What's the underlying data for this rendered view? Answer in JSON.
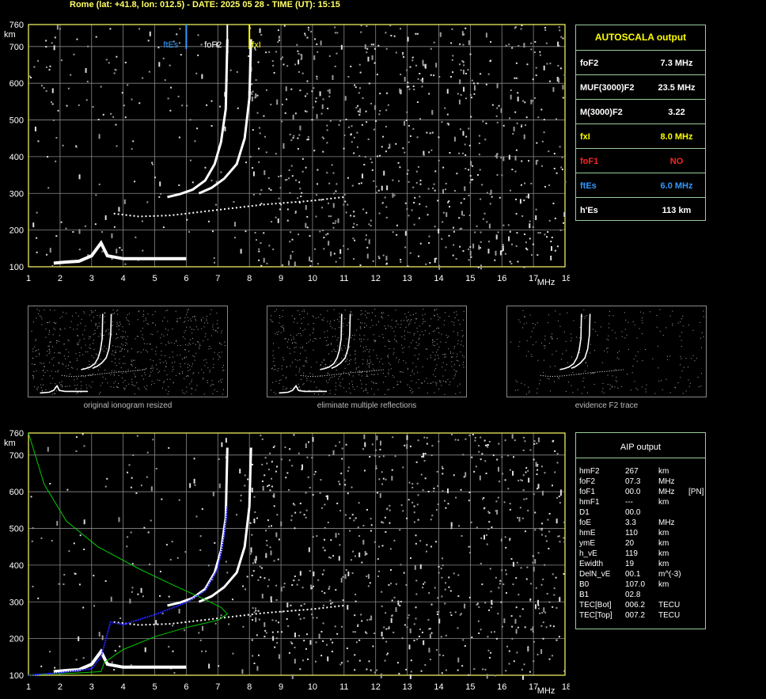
{
  "header": {
    "text": "Rome (lat: +41.8, lon: 012.5) - DATE: 2025 05 28 - TIME (UT): 15:15"
  },
  "axes": {
    "y_unit": "km",
    "x_unit": "MHz",
    "x_ticks": [
      "1",
      "2",
      "3",
      "4",
      "5",
      "6",
      "7",
      "8",
      "9",
      "10",
      "11",
      "12",
      "13",
      "14",
      "15",
      "16",
      "17",
      "18"
    ],
    "y_ticks": [
      "760",
      "700",
      "600",
      "500",
      "400",
      "300",
      "200",
      "100"
    ]
  },
  "markers": {
    "ftEs": "ftEs",
    "foF2": "foF2",
    "fxI": "fxI"
  },
  "colors": {
    "grid": "#888888",
    "frame": "#ffff66",
    "ftEs": "#3399ff",
    "fxI": "#ffff00",
    "profile": "#00cc00",
    "trace": "#2222ff",
    "foF1": "#ff2222"
  },
  "autoscala": {
    "title": "AUTOSCALA output",
    "rows": [
      {
        "label": "foF2",
        "value": "7.3 MHz",
        "color": "#ffffff"
      },
      {
        "label": "MUF(3000)F2",
        "value": "23.5 MHz",
        "color": "#ffffff"
      },
      {
        "label": "M(3000)F2",
        "value": "3.22",
        "color": "#ffffff"
      },
      {
        "label": "fxI",
        "value": "8.0 MHz",
        "color": "#ffff00"
      },
      {
        "label": "foF1",
        "value": "NO",
        "color": "#ff2222"
      },
      {
        "label": "ftEs",
        "value": "6.0 MHz",
        "color": "#3399ff"
      },
      {
        "label": "h'Es",
        "value": "113     km",
        "color": "#ffffff"
      }
    ]
  },
  "aip": {
    "title": "AIP output",
    "rows": [
      {
        "name": "hmF2",
        "value": "267",
        "unit": "km",
        "extra": ""
      },
      {
        "name": "foF2",
        "value": "07.3",
        "unit": "MHz",
        "extra": ""
      },
      {
        "name": "foF1",
        "value": "00.0",
        "unit": "MHz",
        "extra": "[PN]"
      },
      {
        "name": "hmF1",
        "value": "---",
        "unit": "km",
        "extra": ""
      },
      {
        "name": "D1",
        "value": "00.0",
        "unit": "",
        "extra": ""
      },
      {
        "name": "foE",
        "value": "3.3",
        "unit": "MHz",
        "extra": ""
      },
      {
        "name": "hmE",
        "value": "110",
        "unit": "km",
        "extra": ""
      },
      {
        "name": "ymE",
        "value": "20",
        "unit": "km",
        "extra": ""
      },
      {
        "name": "h_vE",
        "value": "119",
        "unit": "km",
        "extra": ""
      },
      {
        "name": "Ewidth",
        "value": "19",
        "unit": "km",
        "extra": ""
      },
      {
        "name": "DelN_vE",
        "value": "00.1",
        "unit": "m^(-3)",
        "extra": ""
      },
      {
        "name": "B0",
        "value": "107.0",
        "unit": "km",
        "extra": ""
      },
      {
        "name": "B1",
        "value": "02.8",
        "unit": "",
        "extra": ""
      },
      {
        "name": "TEC[Bot]",
        "value": "006.2",
        "unit": "TECU",
        "extra": ""
      },
      {
        "name": "TEC[Top]",
        "value": "007.2",
        "unit": "TECU",
        "extra": ""
      }
    ]
  },
  "thumbnails": [
    {
      "caption": "original ionogram resized"
    },
    {
      "caption": "eliminate multiple reflections"
    },
    {
      "caption": "evidence F2 trace"
    }
  ],
  "chart_data": [
    {
      "type": "scatter",
      "xlim": [
        1,
        18
      ],
      "ylim": [
        100,
        760
      ],
      "xlabel": "MHz",
      "ylabel": "km",
      "grid": true,
      "series": [
        {
          "name": "E trace",
          "points": [
            [
              1.8,
              110
            ],
            [
              2.2,
              113
            ],
            [
              2.6,
              115
            ],
            [
              3.0,
              130
            ],
            [
              3.3,
              165
            ],
            [
              3.5,
              130
            ],
            [
              4.0,
              122
            ],
            [
              5.0,
              122
            ],
            [
              6.0,
              122
            ]
          ]
        },
        {
          "name": "F trace (O)",
          "points": [
            [
              5.4,
              290
            ],
            [
              5.8,
              298
            ],
            [
              6.2,
              310
            ],
            [
              6.6,
              335
            ],
            [
              6.9,
              380
            ],
            [
              7.1,
              440
            ],
            [
              7.25,
              530
            ],
            [
              7.3,
              720
            ]
          ]
        },
        {
          "name": "F trace (X)",
          "points": [
            [
              6.4,
              300
            ],
            [
              6.8,
              315
            ],
            [
              7.2,
              340
            ],
            [
              7.6,
              380
            ],
            [
              7.85,
              450
            ],
            [
              8.0,
              560
            ],
            [
              8.05,
              720
            ]
          ]
        },
        {
          "name": "F low trace",
          "points": [
            [
              3.7,
              245
            ],
            [
              4.5,
              237
            ],
            [
              5.5,
              240
            ],
            [
              6.5,
              250
            ],
            [
              7.5,
              260
            ],
            [
              8.5,
              270
            ],
            [
              10,
              280
            ],
            [
              11,
              290
            ]
          ]
        }
      ],
      "markers": [
        {
          "name": "ftEs",
          "x": 6.0
        },
        {
          "name": "foF2",
          "x": 7.3
        },
        {
          "name": "fxI",
          "x": 8.0
        }
      ]
    },
    {
      "type": "line",
      "xlim": [
        1,
        18
      ],
      "ylim": [
        100,
        760
      ],
      "xlabel": "MHz",
      "ylabel": "km",
      "grid": true,
      "series": [
        {
          "name": "AIP profile",
          "points": [
            [
              1.0,
              760
            ],
            [
              1.5,
              620
            ],
            [
              2.2,
              520
            ],
            [
              3.2,
              450
            ],
            [
              4.5,
              390
            ],
            [
              5.6,
              345
            ],
            [
              6.5,
              310
            ],
            [
              7.1,
              285
            ],
            [
              7.3,
              267
            ],
            [
              7.0,
              250
            ],
            [
              6.0,
              230
            ],
            [
              5.0,
              205
            ],
            [
              4.0,
              170
            ],
            [
              3.4,
              135
            ],
            [
              3.3,
              110
            ],
            [
              2.5,
              106
            ],
            [
              1.5,
              103
            ],
            [
              1.0,
              100
            ]
          ]
        },
        {
          "name": "Fitted trace",
          "points": [
            [
              1.0,
              100
            ],
            [
              2.0,
              107
            ],
            [
              3.0,
              118
            ],
            [
              3.3,
              150
            ],
            [
              3.6,
              245
            ],
            [
              4.0,
              238
            ],
            [
              5.0,
              265
            ],
            [
              6.0,
              298
            ],
            [
              6.6,
              330
            ],
            [
              7.0,
              390
            ],
            [
              7.2,
              480
            ],
            [
              7.3,
              560
            ]
          ]
        }
      ]
    }
  ]
}
